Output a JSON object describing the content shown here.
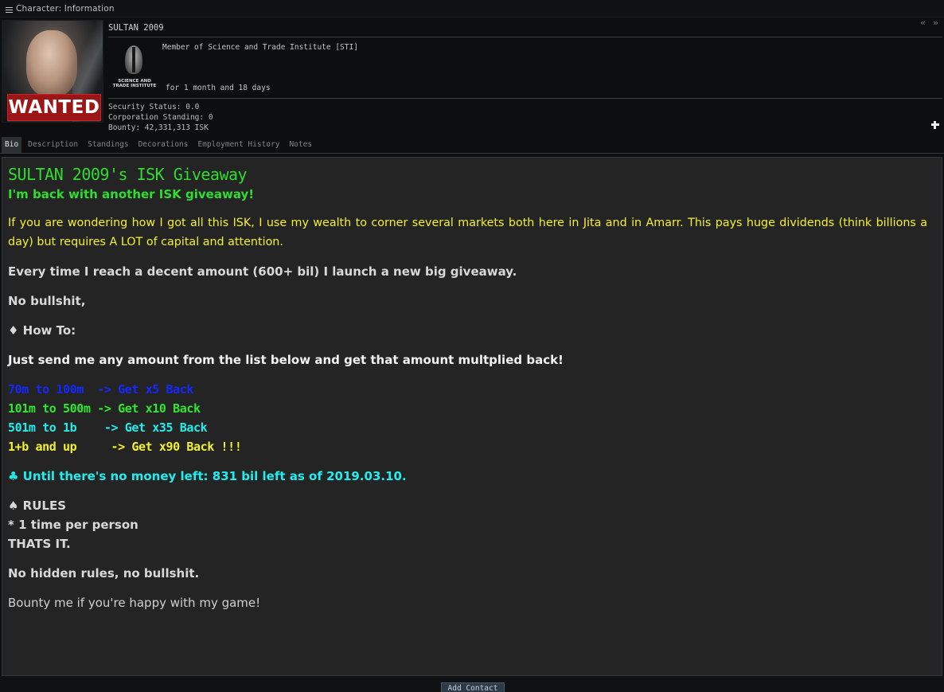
{
  "window": {
    "title": "Character: Information",
    "controls": "« »"
  },
  "character": {
    "name": "SULTAN 2009",
    "portrait_badge": "WANTED",
    "corporation_line": "Member of Science and Trade Institute [STI]",
    "corp_logo_text": "SCIENCE AND TRADE INSTITUTE",
    "membership_duration": "for 1 month and 18 days",
    "security_status": "Security Status: 0.0",
    "corporation_standing": "Corporation Standing: 0",
    "bounty": "Bounty: 42,331,313 ISK"
  },
  "tabs": [
    {
      "label": "Bio",
      "active": true
    },
    {
      "label": "Description",
      "active": false
    },
    {
      "label": "Standings",
      "active": false
    },
    {
      "label": "Decorations",
      "active": false
    },
    {
      "label": "Employment History",
      "active": false
    },
    {
      "label": "Notes",
      "active": false
    }
  ],
  "bio": {
    "title": "SULTAN 2009's ISK Giveaway",
    "subtitle": "I'm back with another ISK giveaway!",
    "intro": "If you are wondering how I got all this ISK, I use my wealth to corner several markets both here in Jita and in Amarr. This pays huge dividends (think billions a day) but requires A LOT of capital and attention.",
    "every_time": "Every time I reach a decent amount (600+ bil) I launch a new big giveaway.",
    "no_bs": "No bullshit,",
    "how_to": "♦ How To:",
    "instructions": "Just send me any amount from the list below and get that amount multplied back!",
    "tiers": [
      "70m to 100m  -> Get x5 Back",
      "101m to 500m -> Get x10 Back",
      "501m to 1b    -> Get x35 Back",
      "1+b and up     -> Get x90 Back !!!"
    ],
    "until": "♣ Until there's no money left: 831 bil left as of 2019.03.10.",
    "rules_header": "♠ RULES",
    "rule1": "* 1 time per person",
    "thats_it": "THATS IT.",
    "no_hidden": "No hidden rules, no bullshit.",
    "bounty_me": "Bounty me if you're happy with my game!"
  },
  "footer": {
    "add_contact_label": "Add Contact"
  },
  "colors": {
    "title_green": "#2fdc2f",
    "yellow": "#f3f22e",
    "blue": "#1428ff",
    "cyan": "#20eeee",
    "wanted_red": "#9b1717"
  }
}
